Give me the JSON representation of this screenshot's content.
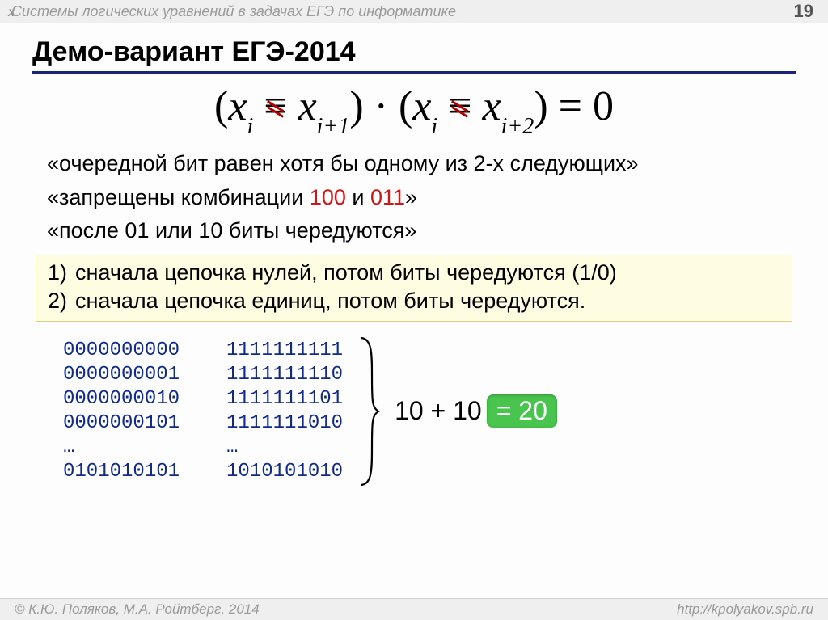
{
  "header": {
    "x_glyph": "x",
    "breadcrumb": "Системы логических уравнений в задачах ЕГЭ по информатике",
    "page_number": "19"
  },
  "slide": {
    "title": "Демо-вариант ЕГЭ-2014"
  },
  "equation": {
    "lparen": "(",
    "rparen": ")",
    "x": "x",
    "sub_i": "i",
    "sub_i1": "i+1",
    "sub_i2": "i+2",
    "equiv": "≡",
    "dot": "·",
    "rhs": "= 0"
  },
  "lines": {
    "l1a": "«очередной бит равен хотя бы одному из 2-х следующих»",
    "l2a": "«запрещены комбинации ",
    "l2b": "100",
    "l2c": " и ",
    "l2d": "011",
    "l2e": "»",
    "l3": "«после 01 или 10 биты чередуются»"
  },
  "box": {
    "r1n": "1)",
    "r1": "сначала цепочка нулей, потом биты чередуются (1/0)",
    "r2n": "2)",
    "r2": "сначала цепочка единиц, потом биты чередуются."
  },
  "bits": {
    "colA": "0000000000\n0000000001\n0000000010\n0000000101\n…\n0101010101",
    "colB": "1111111111\n1111111110\n1111111101\n1111111010\n…\n1010101010"
  },
  "result": {
    "expr": "10 + 10",
    "eq": " = ",
    "answer": "20",
    "combined_answer": "= 20"
  },
  "footer": {
    "left": "© К.Ю. Поляков, М.А. Ройтберг, 2014",
    "right": "http://kpolyakov.spb.ru"
  }
}
